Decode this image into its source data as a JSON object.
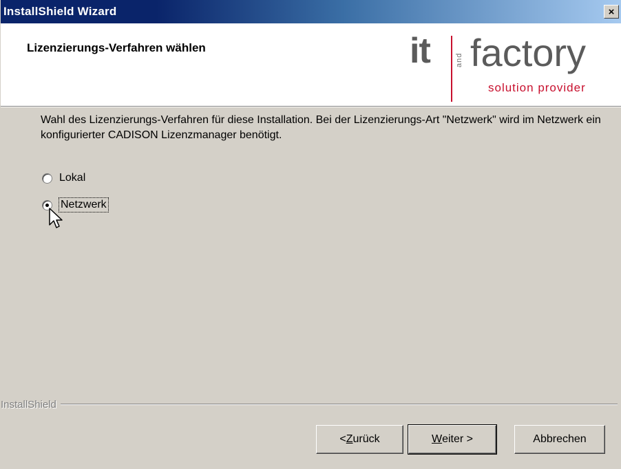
{
  "window": {
    "title": "InstallShield Wizard",
    "close_glyph": "×"
  },
  "header": {
    "heading": "Lizenzierungs-Verfahren wählen",
    "logo": {
      "it": "it",
      "and": "and",
      "factory": "factory",
      "tagline": "solution provider"
    }
  },
  "body": {
    "description": "Wahl des Lizenzierungs-Verfahren für diese Installation. Bei der Lizenzierungs-Art \"Netzwerk\" wird im Netzwerk ein konfigurierter CADISON Lizenzmanager benötigt.",
    "options": [
      {
        "label": "Lokal",
        "checked": false
      },
      {
        "label": "Netzwerk",
        "checked": true
      }
    ]
  },
  "footer": {
    "brand": "InstallShield",
    "back_prefix": "< ",
    "back_mnemonic": "Z",
    "back_rest": "urück",
    "next_mnemonic": "W",
    "next_rest": "eiter >",
    "cancel": "Abbrechen"
  },
  "colors": {
    "titlebar_start": "#0a246a",
    "titlebar_end": "#a6caf0",
    "face": "#d4d0c8",
    "logo_red": "#c8102e"
  }
}
